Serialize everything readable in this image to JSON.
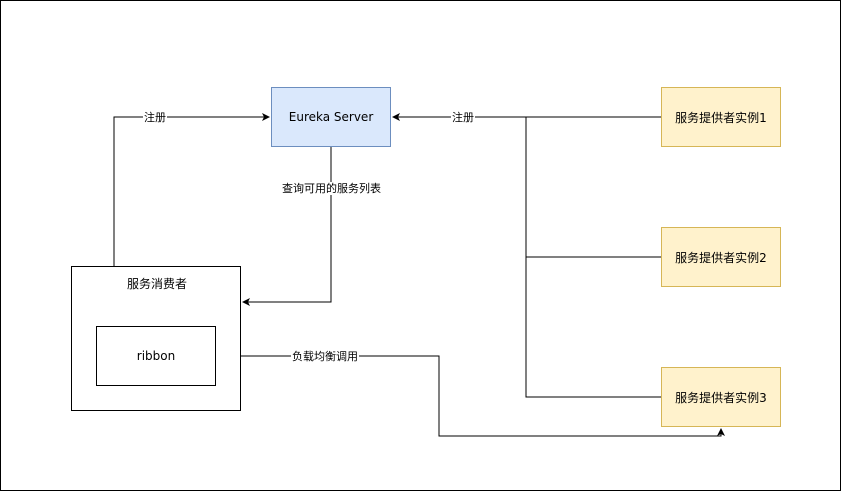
{
  "nodes": {
    "eureka": "Eureka Server",
    "provider1": "服务提供者实例1",
    "provider2": "服务提供者实例2",
    "provider3": "服务提供者实例3",
    "consumer": "服务消费者",
    "ribbon": "ribbon"
  },
  "edges": {
    "consumer_register": "注册",
    "provider_register": "注册",
    "query_services": "查询可用的服务列表",
    "load_balance_call": "负载均衡调用"
  },
  "colors": {
    "eureka_fill": "#dae8fc",
    "eureka_stroke": "#6c8ebf",
    "provider_fill": "#fff2cc",
    "provider_stroke": "#d6b656"
  }
}
